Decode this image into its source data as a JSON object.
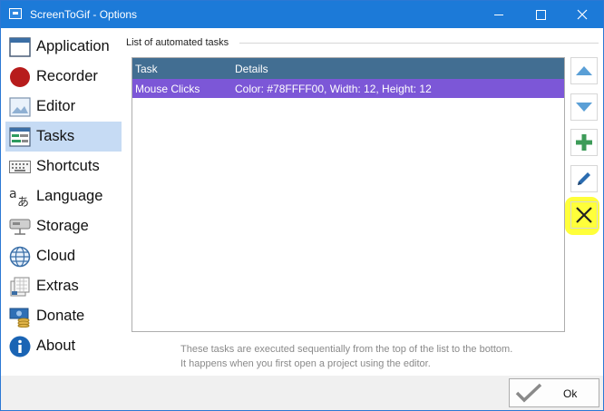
{
  "window": {
    "title": "ScreenToGif - Options",
    "app_icon": "screentogif-app-icon",
    "controls": [
      "minimize-icon",
      "maximize-icon",
      "close-icon"
    ]
  },
  "sidebar": {
    "items": [
      {
        "label": "Application",
        "icon": "application-window-icon",
        "active": false
      },
      {
        "label": "Recorder",
        "icon": "record-circle-icon",
        "active": false
      },
      {
        "label": "Editor",
        "icon": "image-editor-icon",
        "active": false
      },
      {
        "label": "Tasks",
        "icon": "tasks-list-icon",
        "active": true
      },
      {
        "label": "Shortcuts",
        "icon": "keyboard-icon",
        "active": false
      },
      {
        "label": "Language",
        "icon": "translate-icon",
        "active": false
      },
      {
        "label": "Storage",
        "icon": "hard-drive-icon",
        "active": false
      },
      {
        "label": "Cloud",
        "icon": "globe-icon",
        "active": false
      },
      {
        "label": "Extras",
        "icon": "extras-icon",
        "active": false
      },
      {
        "label": "Donate",
        "icon": "money-icon",
        "active": false
      },
      {
        "label": "About",
        "icon": "info-icon",
        "active": false
      }
    ]
  },
  "tasks": {
    "section_title": "List of automated tasks",
    "columns": [
      "Task",
      "Details"
    ],
    "rows": [
      {
        "task": "Mouse Clicks",
        "details": "Color: #78FFFF00, Width: 12, Height: 12",
        "selected": true
      }
    ],
    "buttons": [
      "arrow-up-icon",
      "arrow-down-icon",
      "add-plus-icon",
      "edit-pencil-icon",
      "remove-x-icon"
    ],
    "hint_line1": "These tasks are executed sequentially from the top of the list to the bottom.",
    "hint_line2": "It happens when you first open a project using the editor."
  },
  "footer": {
    "ok_label": "Ok"
  },
  "colors": {
    "titlebar": "#1c7ad8",
    "header": "#426e92",
    "selected_row": "#7c57d7",
    "sidebar_active": "#c6dbf4",
    "highlight": "#ffff3a"
  }
}
